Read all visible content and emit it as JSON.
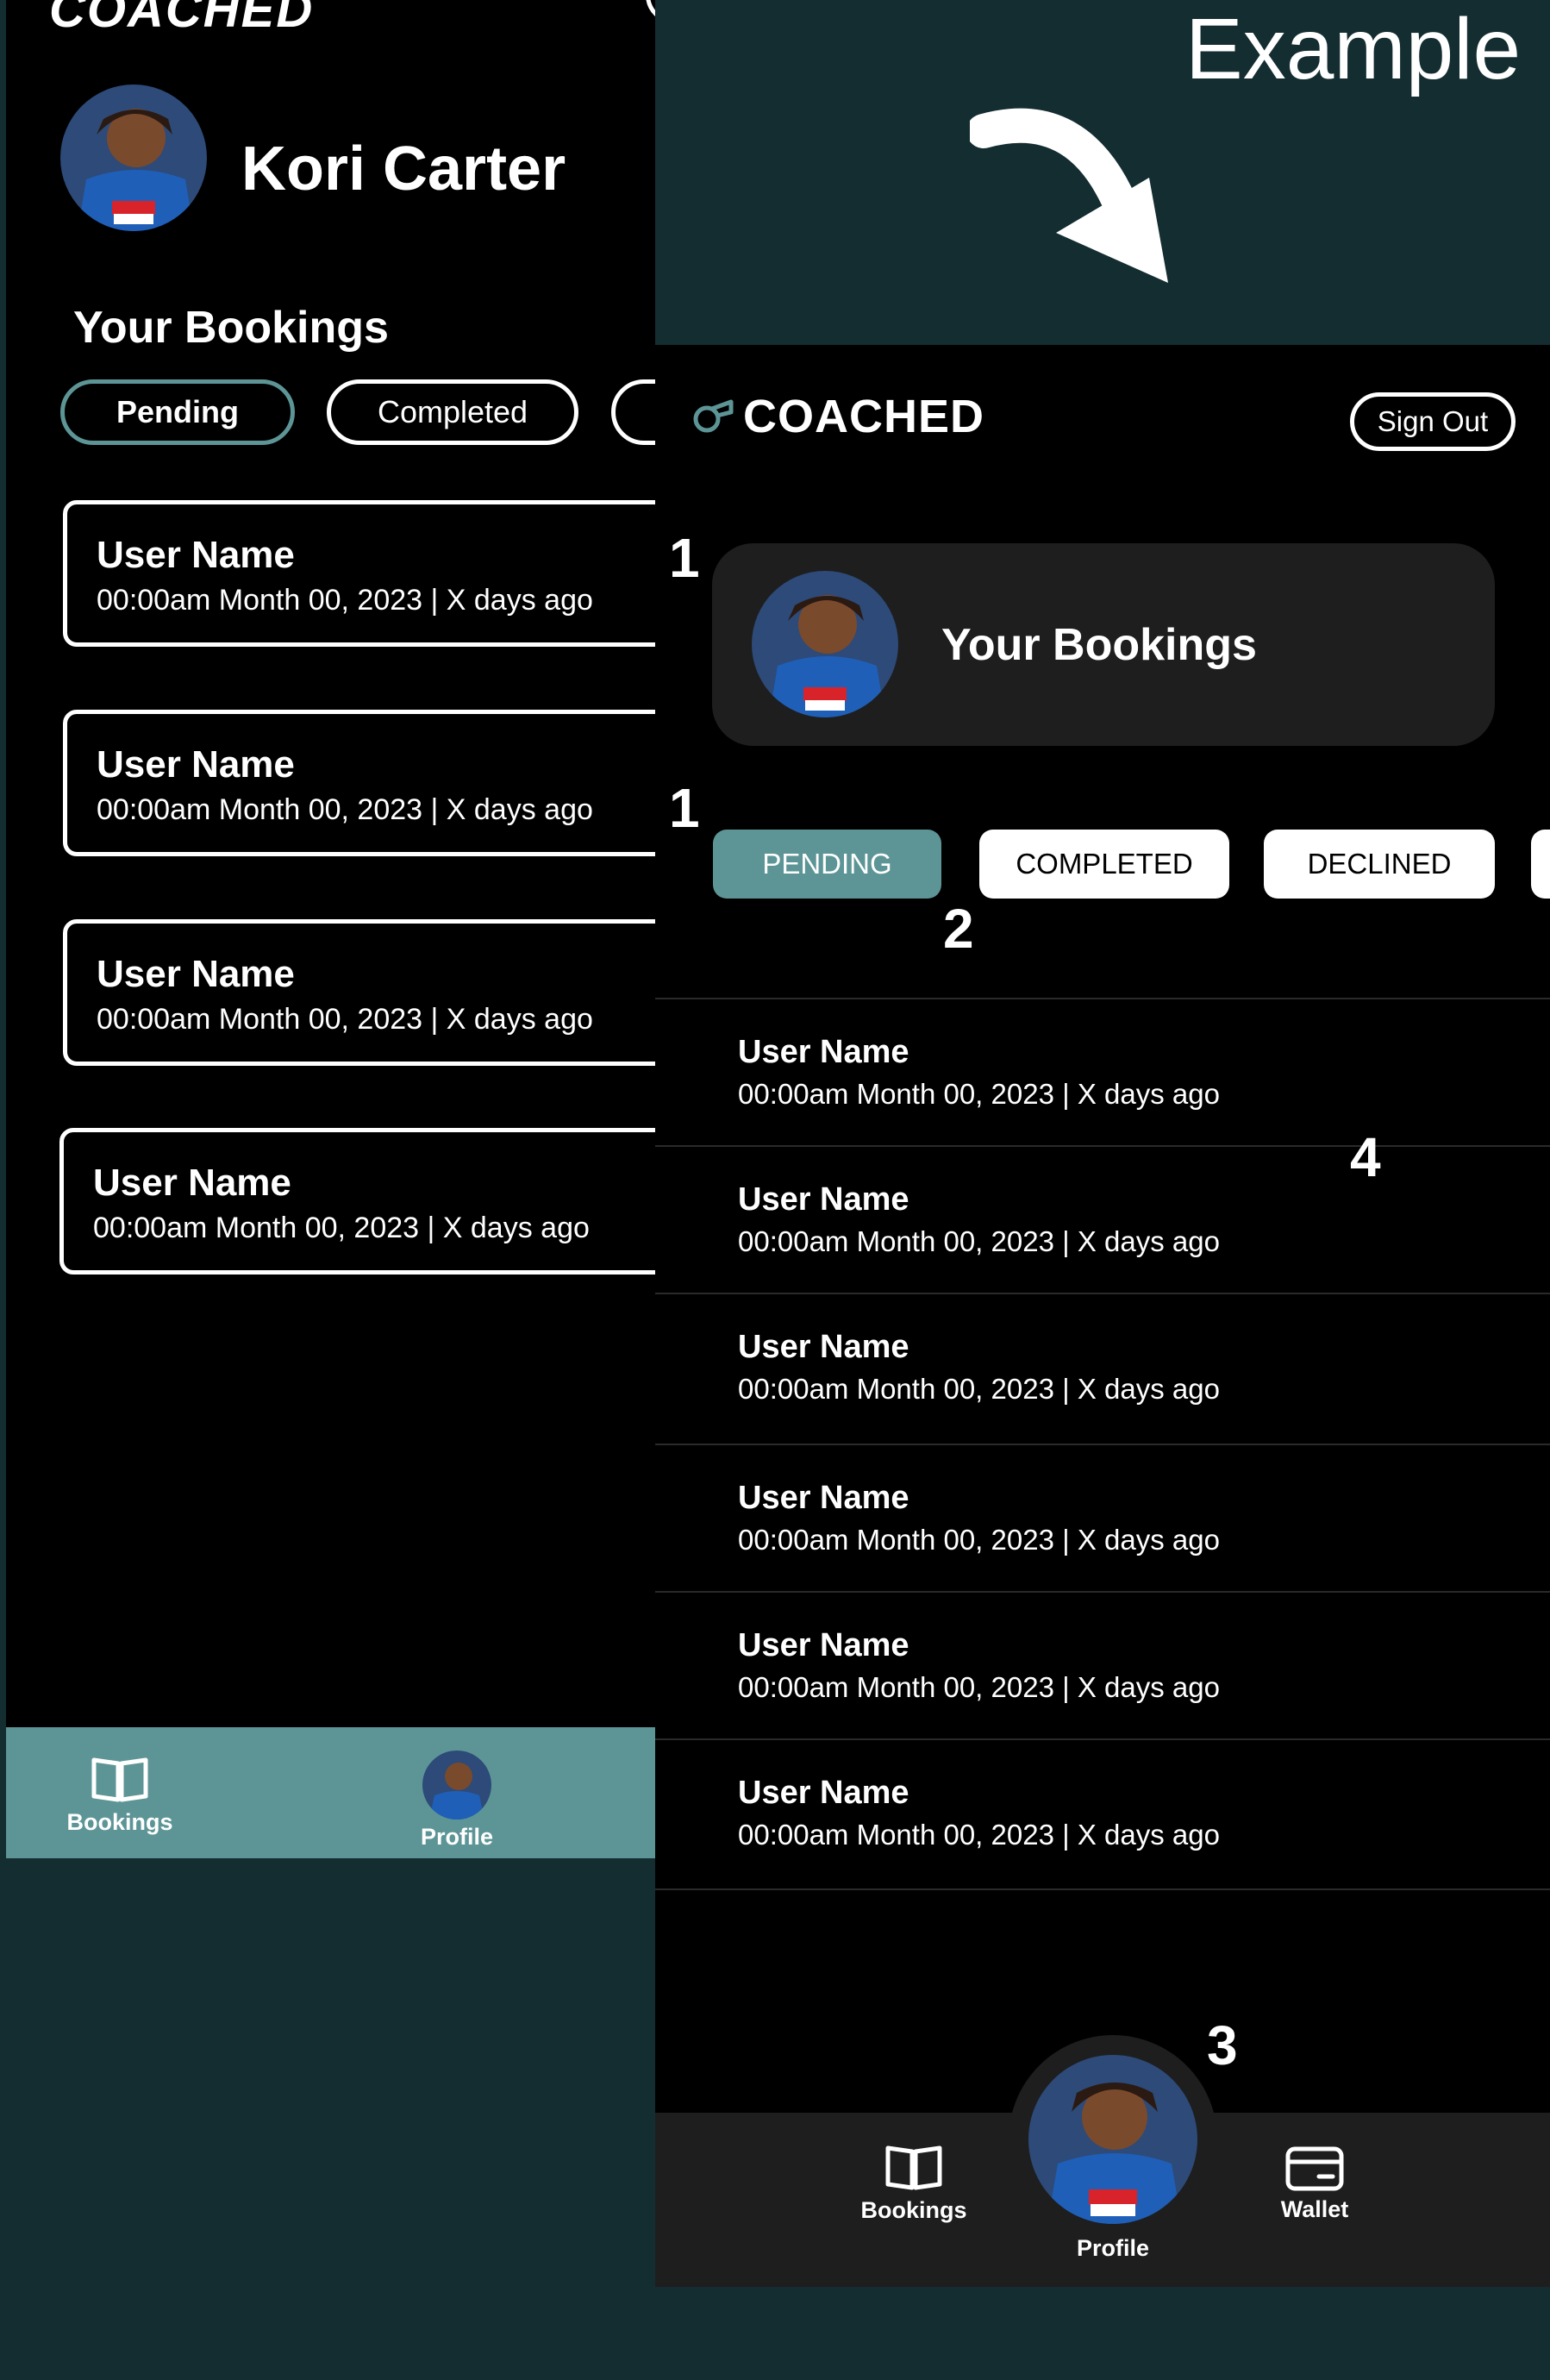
{
  "colors": {
    "accent": "#5d9596",
    "background_panel": "#132d30",
    "phone_background": "#000000",
    "card_dark": "#1e1e1e"
  },
  "left_phone": {
    "brand": "COACHED",
    "profile_name": "Kori Carter",
    "section_title": "Your Bookings",
    "tabs": [
      "Pending",
      "Completed"
    ],
    "bookings": [
      {
        "name": "User Name",
        "datetime": "00:00am Month 00, 2023 | X days ago"
      },
      {
        "name": "User Name",
        "datetime": "00:00am Month 00, 2023 | X days ago"
      },
      {
        "name": "User Name",
        "datetime": "00:00am Month 00, 2023 | X days ago"
      },
      {
        "name": "User Name",
        "datetime": "00:00am Month 00, 2023 | X days ago"
      }
    ],
    "nav": {
      "bookings": "Bookings",
      "profile": "Profile"
    }
  },
  "example": {
    "title": "Example"
  },
  "right_phone": {
    "brand": "COACHED",
    "sign_out": "Sign Out",
    "section_title": "Your Bookings",
    "tabs": [
      "PENDING",
      "COMPLETED",
      "DECLINED"
    ],
    "bookings": [
      {
        "name": "User Name",
        "datetime": "00:00am Month 00, 2023 | X days ago"
      },
      {
        "name": "User Name",
        "datetime": "00:00am Month 00, 2023 | X days ago"
      },
      {
        "name": "User Name",
        "datetime": "00:00am Month 00, 2023 | X days ago"
      },
      {
        "name": "User Name",
        "datetime": "00:00am Month 00, 2023 | X days ago"
      },
      {
        "name": "User Name",
        "datetime": "00:00am Month 00, 2023 | X days ago"
      },
      {
        "name": "User Name",
        "datetime": "00:00am Month 00, 2023 | X days ago"
      }
    ],
    "nav": {
      "bookings": "Bookings",
      "profile": "Profile",
      "wallet": "Wallet"
    }
  },
  "markers": [
    "1",
    "1",
    "2",
    "4",
    "3"
  ]
}
